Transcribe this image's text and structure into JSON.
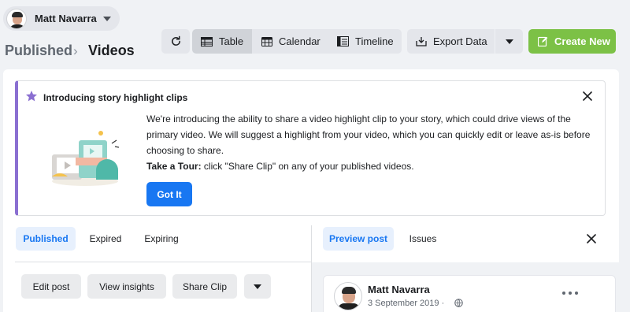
{
  "account": {
    "name": "Matt Navarra"
  },
  "breadcrumb": {
    "parent": "Published",
    "separator": "›",
    "current": "Videos"
  },
  "toolbar": {
    "table_label": "Table",
    "calendar_label": "Calendar",
    "timeline_label": "Timeline",
    "export_label": "Export Data",
    "create_label": "Create New"
  },
  "banner": {
    "title": "Introducing story highlight clips",
    "body": "We're introducing the ability to share a video highlight clip to your story, which could drive views of the primary video. We will suggest a highlight from your video, which you can quickly edit or leave as-is before choosing to share.",
    "tour_bold": "Take a Tour:",
    "tour_text": " click \"Share Clip\" on any of your published videos.",
    "button_label": "Got It"
  },
  "left_tabs": [
    "Published",
    "Expired",
    "Expiring"
  ],
  "actions": {
    "edit_post": "Edit post",
    "view_insights": "View insights",
    "share_clip": "Share Clip"
  },
  "right_tabs": [
    "Preview post",
    "Issues"
  ],
  "post": {
    "author": "Matt Navarra",
    "date": "3 September 2019 ·"
  },
  "colors": {
    "accent": "#1877f2",
    "create": "#7cc146",
    "banner_stripe": "#8a6fd1"
  }
}
